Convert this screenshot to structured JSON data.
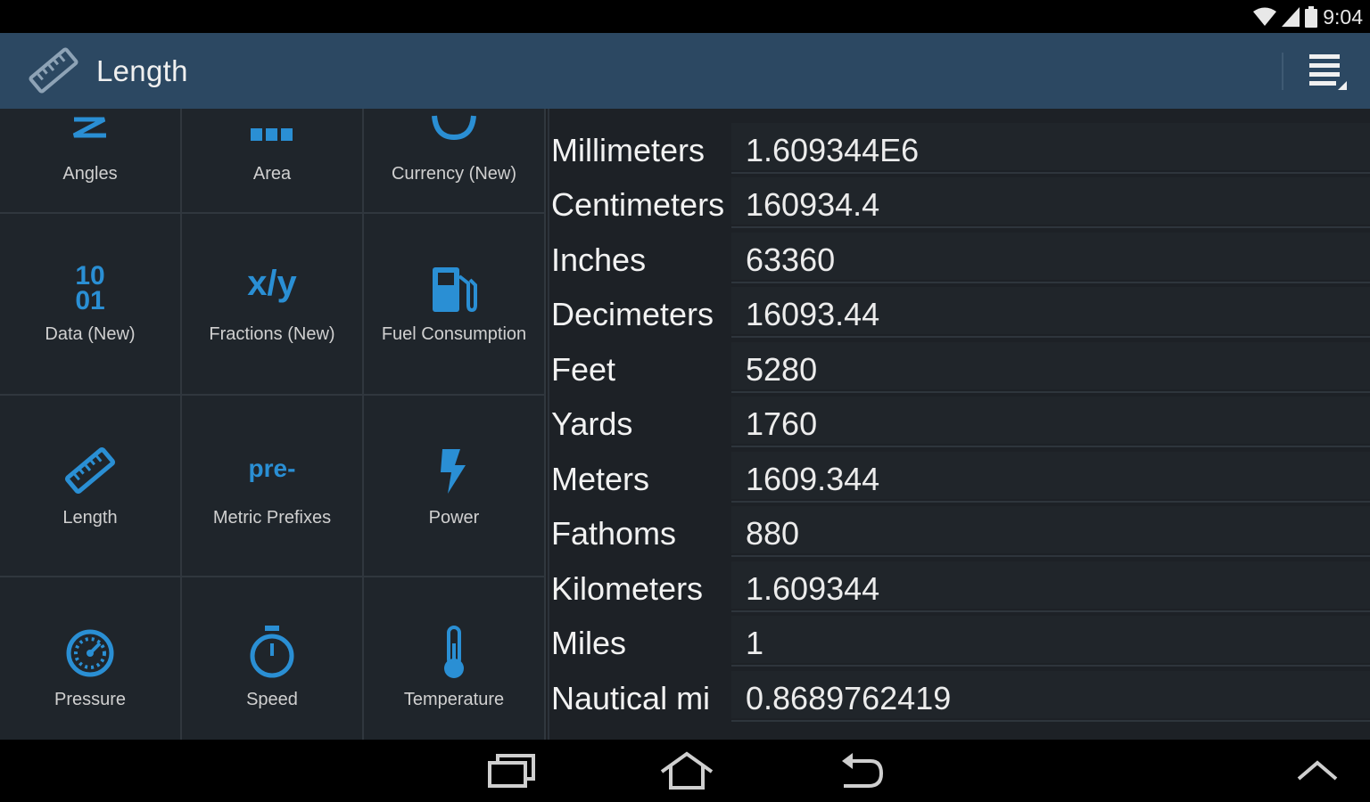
{
  "status_bar": {
    "time": "9:04"
  },
  "action_bar": {
    "title": "Length"
  },
  "categories": [
    {
      "label": "Angles"
    },
    {
      "label": "Area"
    },
    {
      "label": "Currency (New)"
    },
    {
      "label": "Data (New)",
      "icon_text_1": "10",
      "icon_text_2": "01"
    },
    {
      "label": "Fractions (New)",
      "icon_text": "x/y"
    },
    {
      "label": "Fuel Consumption"
    },
    {
      "label": "Length"
    },
    {
      "label": "Metric Prefixes",
      "icon_text": "pre-"
    },
    {
      "label": "Power"
    },
    {
      "label": "Pressure"
    },
    {
      "label": "Speed"
    },
    {
      "label": "Temperature"
    }
  ],
  "conversions": [
    {
      "unit": "Millimeters",
      "value": "1.609344E6"
    },
    {
      "unit": "Centimeters",
      "value": "160934.4"
    },
    {
      "unit": "Inches",
      "value": "63360"
    },
    {
      "unit": "Decimeters",
      "value": "16093.44"
    },
    {
      "unit": "Feet",
      "value": "5280"
    },
    {
      "unit": "Yards",
      "value": "1760"
    },
    {
      "unit": "Meters",
      "value": "1609.344"
    },
    {
      "unit": "Fathoms",
      "value": "880"
    },
    {
      "unit": "Kilometers",
      "value": "1.609344"
    },
    {
      "unit": "Miles",
      "value": "1"
    },
    {
      "unit": "Nautical mi",
      "value": "0.8689762419"
    }
  ],
  "colors": {
    "accent": "#2a8fd4",
    "action_bar": "#2c4862",
    "background": "#1d2126"
  }
}
